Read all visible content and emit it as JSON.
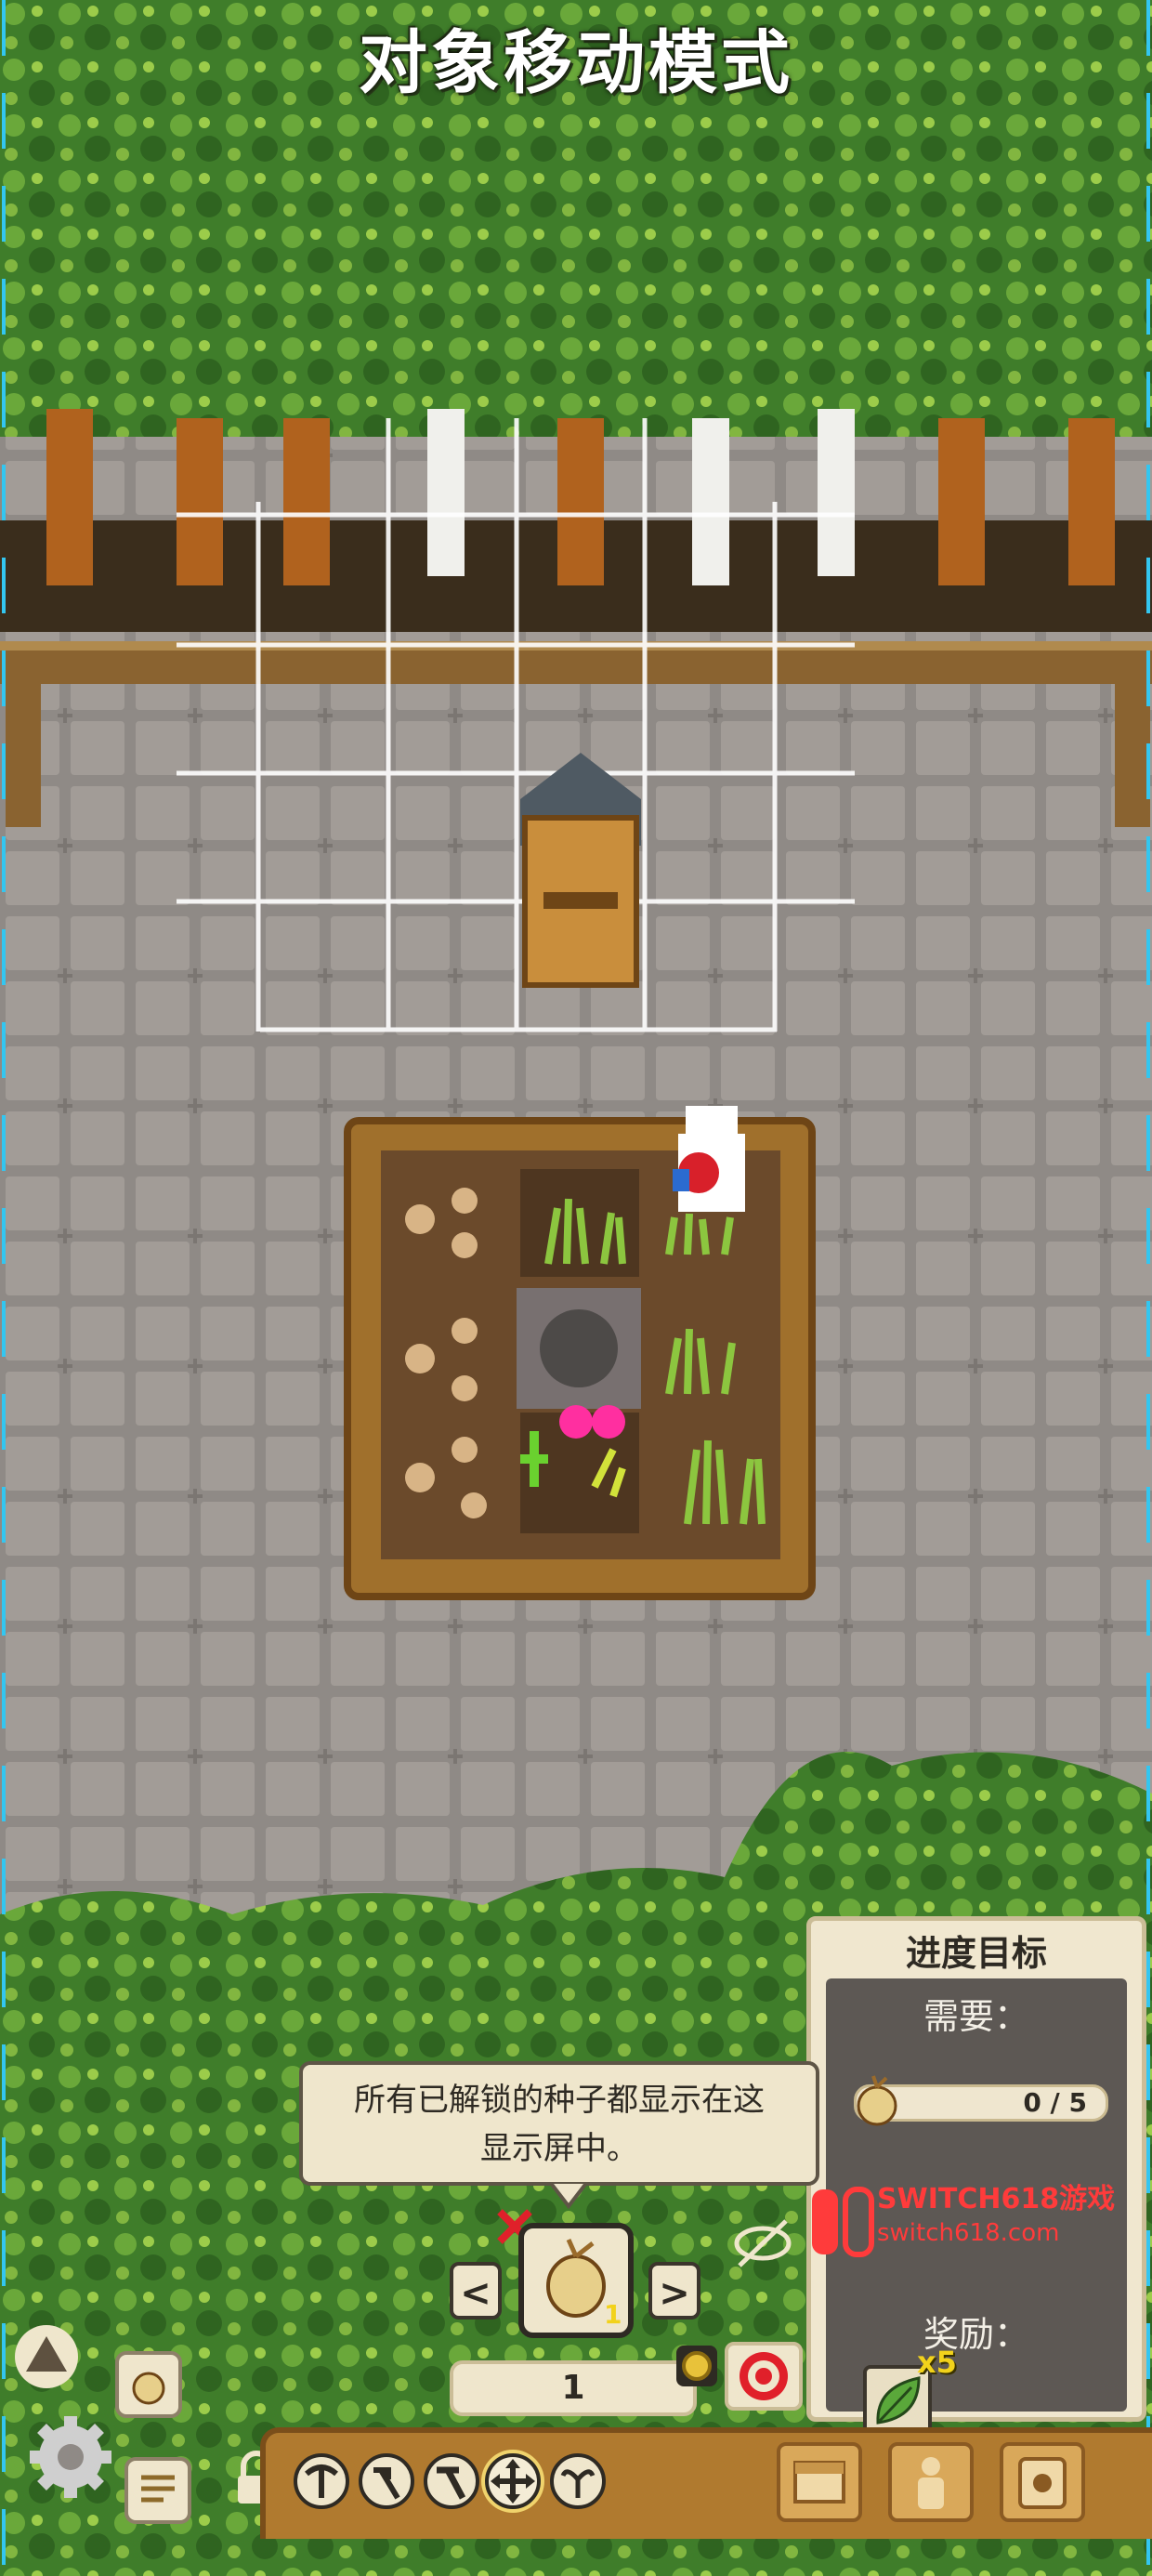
{
  "mode_title": "对象移动模式",
  "goal_panel": {
    "title": "进度目标",
    "need_label": "需要：",
    "progress_text": "0 / 5",
    "progress_fraction": 0,
    "reward_label": "奖励：",
    "reward_qty": "x5",
    "reward_icon": "leaf-icon",
    "required_icon": "seed-pouch-icon"
  },
  "tooltip": {
    "line1": "所有已解锁的种子都显示在这",
    "line2": "显示屏中。"
  },
  "seed_selector": {
    "prev_label": "<",
    "next_label": ">",
    "slot_count": "1",
    "quantity": "1",
    "remove_icon": "remove-x-icon",
    "hide_icon": "eye-slash-icon"
  },
  "toolbar": {
    "tools": [
      "pickaxe-icon",
      "hoe-icon",
      "hammer-icon",
      "move-arrows-icon",
      "sprout-icon"
    ],
    "active_tool": "move-arrows-icon",
    "menus": [
      "storage-icon",
      "character-icon",
      "journal-icon"
    ]
  },
  "side_buttons": [
    "compost-icon",
    "seed-bag-icon",
    "settings-icon",
    "notes-icon",
    "lock-icon"
  ],
  "watermark": {
    "line1": "SWITCH618游戏",
    "line2": "switch618.com"
  },
  "colors": {
    "ground": "#8f8a86",
    "grass": "#3f7d2a",
    "soil": "#6b4a2b",
    "panel": "#f0e7cf",
    "accent_yellow": "#f2d21b",
    "toolbar_wood": "#b07a2f"
  }
}
